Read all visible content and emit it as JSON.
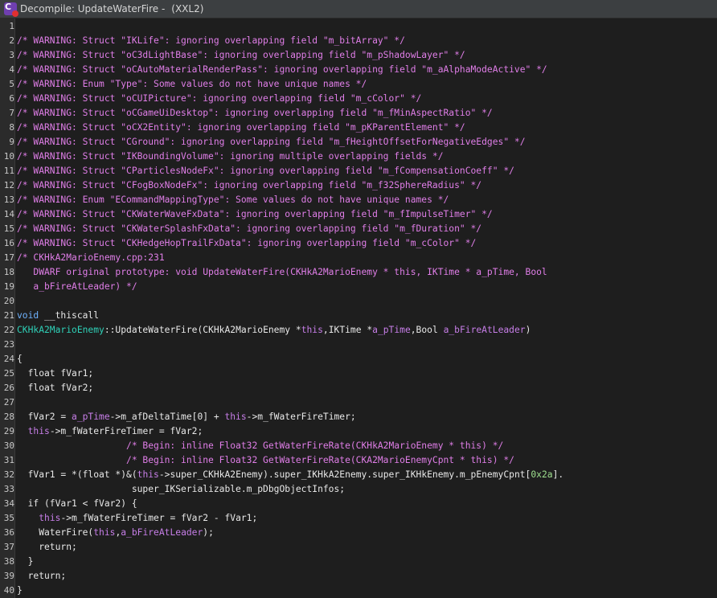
{
  "window": {
    "title": "Decompile: UpdateWaterFire - ",
    "subtitle": "(XXL2)",
    "icon": "decompiler-icon"
  },
  "colors": {
    "background": "#1e1e1e",
    "comment": "#e07ee8",
    "keyword": "#6fb3ff",
    "type": "#2fd1b8",
    "param": "#c77ee8",
    "number": "#9fe08f",
    "text": "#e8e8e8"
  },
  "code_lines": [
    {
      "n": "1",
      "segs": []
    },
    {
      "n": "2",
      "segs": [
        {
          "c": "cm",
          "t": "/* WARNING: Struct \"IKLife\": ignoring overlapping field \"m_bitArray\" */"
        }
      ]
    },
    {
      "n": "3",
      "segs": [
        {
          "c": "cm",
          "t": "/* WARNING: Struct \"oC3dLightBase\": ignoring overlapping field \"m_pShadowLayer\" */"
        }
      ]
    },
    {
      "n": "4",
      "segs": [
        {
          "c": "cm",
          "t": "/* WARNING: Struct \"oCAutoMaterialRenderPass\": ignoring overlapping field \"m_aAlphaModeActive\" */"
        }
      ]
    },
    {
      "n": "5",
      "segs": [
        {
          "c": "cm",
          "t": "/* WARNING: Enum \"Type\": Some values do not have unique names */"
        }
      ]
    },
    {
      "n": "6",
      "segs": [
        {
          "c": "cm",
          "t": "/* WARNING: Struct \"oCUIPicture\": ignoring overlapping field \"m_cColor\" */"
        }
      ]
    },
    {
      "n": "7",
      "segs": [
        {
          "c": "cm",
          "t": "/* WARNING: Struct \"oCGameUiDesktop\": ignoring overlapping field \"m_fMinAspectRatio\" */"
        }
      ]
    },
    {
      "n": "8",
      "segs": [
        {
          "c": "cm",
          "t": "/* WARNING: Struct \"oCX2Entity\": ignoring overlapping field \"m_pKParentElement\" */"
        }
      ]
    },
    {
      "n": "9",
      "segs": [
        {
          "c": "cm",
          "t": "/* WARNING: Struct \"CGround\": ignoring overlapping field \"m_fHeightOffsetForNegativeEdges\" */"
        }
      ]
    },
    {
      "n": "10",
      "segs": [
        {
          "c": "cm",
          "t": "/* WARNING: Struct \"IKBoundingVolume\": ignoring multiple overlapping fields */"
        }
      ]
    },
    {
      "n": "11",
      "segs": [
        {
          "c": "cm",
          "t": "/* WARNING: Struct \"CParticlesNodeFx\": ignoring overlapping field \"m_fCompensationCoeff\" */"
        }
      ]
    },
    {
      "n": "12",
      "segs": [
        {
          "c": "cm",
          "t": "/* WARNING: Struct \"CFogBoxNodeFx\": ignoring overlapping field \"m_f32SphereRadius\" */"
        }
      ]
    },
    {
      "n": "13",
      "segs": [
        {
          "c": "cm",
          "t": "/* WARNING: Enum \"ECommandMappingType\": Some values do not have unique names */"
        }
      ]
    },
    {
      "n": "14",
      "segs": [
        {
          "c": "cm",
          "t": "/* WARNING: Struct \"CKWaterWaveFxData\": ignoring overlapping field \"m_fImpulseTimer\" */"
        }
      ]
    },
    {
      "n": "15",
      "segs": [
        {
          "c": "cm",
          "t": "/* WARNING: Struct \"CKWaterSplashFxData\": ignoring overlapping field \"m_fDuration\" */"
        }
      ]
    },
    {
      "n": "16",
      "segs": [
        {
          "c": "cm",
          "t": "/* WARNING: Struct \"CKHedgeHopTrailFxData\": ignoring overlapping field \"m_cColor\" */"
        }
      ]
    },
    {
      "n": "17",
      "segs": [
        {
          "c": "cm",
          "t": "/* CKHkA2MarioEnemy.cpp:231"
        }
      ]
    },
    {
      "n": "18",
      "segs": [
        {
          "c": "cm",
          "t": "   DWARF original prototype: void UpdateWaterFire(CKHkA2MarioEnemy * this, IKTime * a_pTime, Bool"
        }
      ]
    },
    {
      "n": "19",
      "segs": [
        {
          "c": "cm",
          "t": "   a_bFireAtLeader) */"
        }
      ]
    },
    {
      "n": "20",
      "segs": []
    },
    {
      "n": "21",
      "segs": [
        {
          "c": "kw",
          "t": "void"
        },
        {
          "c": "fn",
          "t": " __thiscall"
        }
      ]
    },
    {
      "n": "22",
      "segs": [
        {
          "c": "ty",
          "t": "CKHkA2MarioEnemy"
        },
        {
          "c": "fn",
          "t": "::UpdateWaterFire("
        },
        {
          "c": "fn",
          "t": "CKHkA2MarioEnemy "
        },
        {
          "c": "fn",
          "t": "*"
        },
        {
          "c": "pa",
          "t": "this"
        },
        {
          "c": "fn",
          "t": ",IKTime *"
        },
        {
          "c": "pa",
          "t": "a_pTime"
        },
        {
          "c": "fn",
          "t": ",Bool "
        },
        {
          "c": "pa",
          "t": "a_bFireAtLeader"
        },
        {
          "c": "fn",
          "t": ")"
        }
      ]
    },
    {
      "n": "23",
      "segs": []
    },
    {
      "n": "24",
      "segs": [
        {
          "c": "fn",
          "t": "{"
        }
      ]
    },
    {
      "n": "25",
      "segs": [
        {
          "c": "fn",
          "t": "  float fVar1;"
        }
      ]
    },
    {
      "n": "26",
      "segs": [
        {
          "c": "fn",
          "t": "  float fVar2;"
        }
      ]
    },
    {
      "n": "27",
      "segs": []
    },
    {
      "n": "28",
      "segs": [
        {
          "c": "fn",
          "t": "  fVar2 = "
        },
        {
          "c": "pa",
          "t": "a_pTime"
        },
        {
          "c": "fn",
          "t": "->m_afDeltaTime[0] + "
        },
        {
          "c": "pa",
          "t": "this"
        },
        {
          "c": "fn",
          "t": "->m_fWaterFireTimer;"
        }
      ]
    },
    {
      "n": "29",
      "segs": [
        {
          "c": "fn",
          "t": "  "
        },
        {
          "c": "pa",
          "t": "this"
        },
        {
          "c": "fn",
          "t": "->m_fWaterFireTimer = fVar2;"
        }
      ]
    },
    {
      "n": "30",
      "segs": [
        {
          "c": "cm",
          "t": "                    /* Begin: inline Float32 GetWaterFireRate(CKHkA2MarioEnemy * this) */"
        }
      ]
    },
    {
      "n": "31",
      "segs": [
        {
          "c": "cm",
          "t": "                    /* Begin: inline Float32 GetWaterFireRate(CKA2MarioEnemyCpnt * this) */"
        }
      ]
    },
    {
      "n": "32",
      "segs": [
        {
          "c": "fn",
          "t": "  fVar1 = *(float *)&("
        },
        {
          "c": "pa",
          "t": "this"
        },
        {
          "c": "fn",
          "t": "->super_CKHkA2Enemy).super_IKHkA2Enemy.super_IKHkEnemy.m_pEnemyCpnt["
        },
        {
          "c": "num",
          "t": "0x2a"
        },
        {
          "c": "fn",
          "t": "]."
        }
      ]
    },
    {
      "n": "33",
      "segs": [
        {
          "c": "fn",
          "t": "                     super_IKSerializable.m_pDbgObjectInfos;"
        }
      ]
    },
    {
      "n": "34",
      "segs": [
        {
          "c": "fn",
          "t": "  if (fVar1 < fVar2) {"
        }
      ]
    },
    {
      "n": "35",
      "segs": [
        {
          "c": "fn",
          "t": "    "
        },
        {
          "c": "pa",
          "t": "this"
        },
        {
          "c": "fn",
          "t": "->m_fWaterFireTimer = fVar2 - fVar1;"
        }
      ]
    },
    {
      "n": "36",
      "segs": [
        {
          "c": "fn",
          "t": "    WaterFire("
        },
        {
          "c": "pa",
          "t": "this"
        },
        {
          "c": "fn",
          "t": ","
        },
        {
          "c": "pa",
          "t": "a_bFireAtLeader"
        },
        {
          "c": "fn",
          "t": ");"
        }
      ]
    },
    {
      "n": "37",
      "segs": [
        {
          "c": "fn",
          "t": "    return;"
        }
      ]
    },
    {
      "n": "38",
      "segs": [
        {
          "c": "fn",
          "t": "  }"
        }
      ]
    },
    {
      "n": "39",
      "segs": [
        {
          "c": "fn",
          "t": "  return;"
        }
      ]
    },
    {
      "n": "40",
      "segs": [
        {
          "c": "fn",
          "t": "}"
        }
      ]
    }
  ]
}
